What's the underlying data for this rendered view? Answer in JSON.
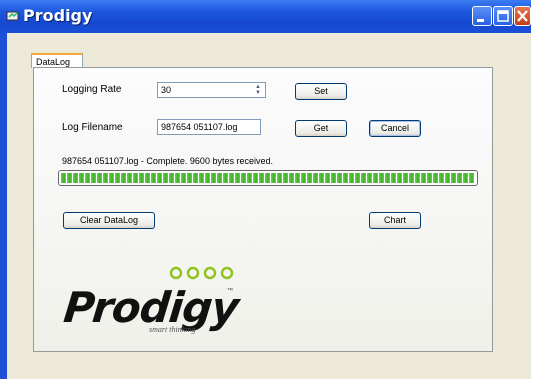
{
  "window": {
    "title": "Prodigy",
    "controls": [
      "minimize-icon",
      "maximize-icon",
      "close-icon"
    ]
  },
  "tabs": [
    {
      "label": "DataLog",
      "selected": true
    }
  ],
  "datalog": {
    "logging_rate_label": "Logging Rate",
    "logging_rate_value": "30",
    "set_label": "Set",
    "log_filename_label": "Log Filename",
    "log_filename_value": "987654 051107.log",
    "get_label": "Get",
    "cancel_label": "Cancel",
    "status_text": "987654 051107.log - Complete. 9600 bytes received.",
    "progress_fraction": 1.0,
    "clear_label": "Clear DataLog",
    "chart_label": "Chart"
  },
  "logo": {
    "wordmark": "Prodigy",
    "trademark": "™",
    "tagline": "smart thinking"
  },
  "colors": {
    "titlebar": "#1f4fd6",
    "progress": "#4cc035",
    "logo_dots": "#8ec21c"
  }
}
